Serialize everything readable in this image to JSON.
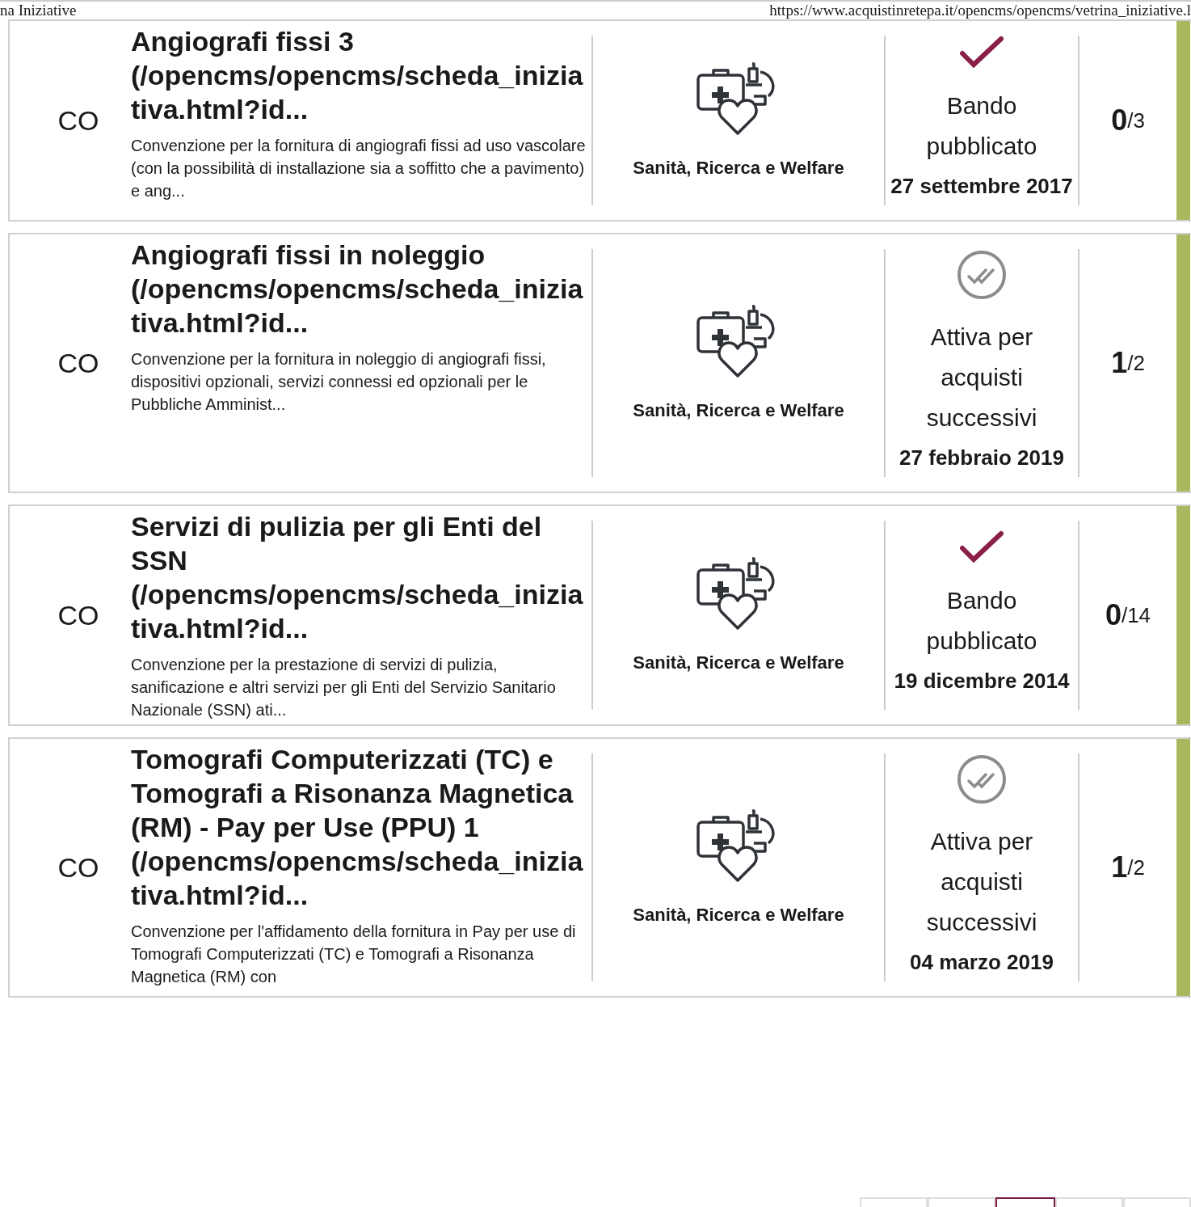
{
  "print_header": {
    "left": "na Iniziative",
    "right": "https://www.acquistinretepa.it/opencms/opencms/vetrina_iniziative.l"
  },
  "initiatives": [
    {
      "type_code": "CO",
      "title": "Angiografi fissi 3 (/opencms/opencms/scheda_iniziativa.html?id...",
      "description": "Convenzione per la fornitura di angiografi fissi ad uso vascolare (con la possibilità di installazione sia a soffitto che a pavimento) e ang...",
      "sector": "Sanità, Ricerca e Welfare",
      "status": {
        "kind": "published",
        "label": "Bando pubblicato",
        "date": "27 settembre 2017"
      },
      "count": "0",
      "total": "/3"
    },
    {
      "type_code": "CO",
      "title": "Angiografi fissi in noleggio (/opencms/opencms/scheda_iniziativa.html?id...",
      "description": "Convenzione per la fornitura in noleggio di angiografi fissi, dispositivi opzionali, servizi connessi ed opzionali per le Pubbliche Amminist...",
      "sector": "Sanità, Ricerca e Welfare",
      "status": {
        "kind": "active",
        "label": "Attiva per acquisti successivi",
        "date": "27 febbraio 2019"
      },
      "count": "1",
      "total": "/2"
    },
    {
      "type_code": "CO",
      "title": "Servizi di pulizia per gli Enti del SSN (/opencms/opencms/scheda_iniziativa.html?id...",
      "description": "Convenzione per la prestazione di servizi di pulizia, sanificazione e altri servizi per gli Enti del Servizio Sanitario Nazionale (SSN) ati...",
      "sector": "Sanità, Ricerca e Welfare",
      "status": {
        "kind": "published",
        "label": "Bando pubblicato",
        "date": "19 dicembre 2014"
      },
      "count": "0",
      "total": "/14"
    },
    {
      "type_code": "CO",
      "title": "Tomografi Computerizzati (TC) e Tomografi a Risonanza Magnetica (RM) - Pay per Use (PPU) 1 (/opencms/opencms/scheda_iniziativa.html?id...",
      "description": "Convenzione per l'affidamento della fornitura in Pay per use di Tomografi Computerizzati (TC) e Tomografi a Risonanza Magnetica (RM) con",
      "sector": "Sanità, Ricerca e Welfare",
      "status": {
        "kind": "active",
        "label": "Attiva per acquisti successivi",
        "date": "04 marzo 2019"
      },
      "count": "1",
      "total": "/2"
    }
  ],
  "pagination": [
    {
      "selected": false
    },
    {
      "selected": false
    },
    {
      "selected": true
    },
    {
      "selected": false
    },
    {
      "selected": false
    }
  ]
}
